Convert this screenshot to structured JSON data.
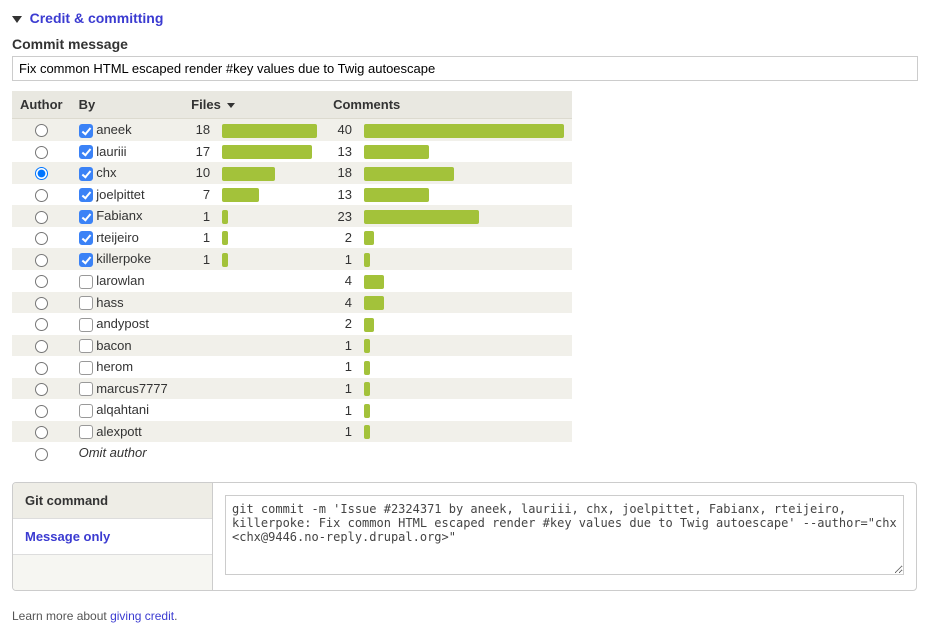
{
  "section_title": "Credit & committing",
  "commit_label": "Commit message",
  "commit_value": "Fix common HTML escaped render #key values due to Twig autoescape",
  "headers": {
    "author": "Author",
    "by": "By",
    "files": "Files",
    "comments": "Comments"
  },
  "omit_label": "Omit author",
  "max_files": 18,
  "max_comments": 40,
  "rows": [
    {
      "author_selected": false,
      "by_checked": true,
      "name": "aneek",
      "files": 18,
      "comments": 40
    },
    {
      "author_selected": false,
      "by_checked": true,
      "name": "lauriii",
      "files": 17,
      "comments": 13
    },
    {
      "author_selected": true,
      "by_checked": true,
      "name": "chx",
      "files": 10,
      "comments": 18
    },
    {
      "author_selected": false,
      "by_checked": true,
      "name": "joelpittet",
      "files": 7,
      "comments": 13
    },
    {
      "author_selected": false,
      "by_checked": true,
      "name": "Fabianx",
      "files": 1,
      "comments": 23
    },
    {
      "author_selected": false,
      "by_checked": true,
      "name": "rteijeiro",
      "files": 1,
      "comments": 2
    },
    {
      "author_selected": false,
      "by_checked": true,
      "name": "killerpoke",
      "files": 1,
      "comments": 1
    },
    {
      "author_selected": false,
      "by_checked": false,
      "name": "larowlan",
      "files": null,
      "comments": 4
    },
    {
      "author_selected": false,
      "by_checked": false,
      "name": "hass",
      "files": null,
      "comments": 4
    },
    {
      "author_selected": false,
      "by_checked": false,
      "name": "andypost",
      "files": null,
      "comments": 2
    },
    {
      "author_selected": false,
      "by_checked": false,
      "name": "bacon",
      "files": null,
      "comments": 1
    },
    {
      "author_selected": false,
      "by_checked": false,
      "name": "herom",
      "files": null,
      "comments": 1
    },
    {
      "author_selected": false,
      "by_checked": false,
      "name": "marcus7777",
      "files": null,
      "comments": 1
    },
    {
      "author_selected": false,
      "by_checked": false,
      "name": "alqahtani",
      "files": null,
      "comments": 1
    },
    {
      "author_selected": false,
      "by_checked": false,
      "name": "alexpott",
      "files": null,
      "comments": 1
    }
  ],
  "cmd_tabs": {
    "header": "Git command",
    "active": "Message only"
  },
  "cmd_value": "git commit -m 'Issue #2324371 by aneek, lauriii, chx, joelpittet, Fabianx, rteijeiro, killerpoke: Fix common HTML escaped render #key values due to Twig autoescape' --author=\"chx <chx@9446.no-reply.drupal.org>\"",
  "footer_text": "Learn more about ",
  "footer_link": "giving credit"
}
